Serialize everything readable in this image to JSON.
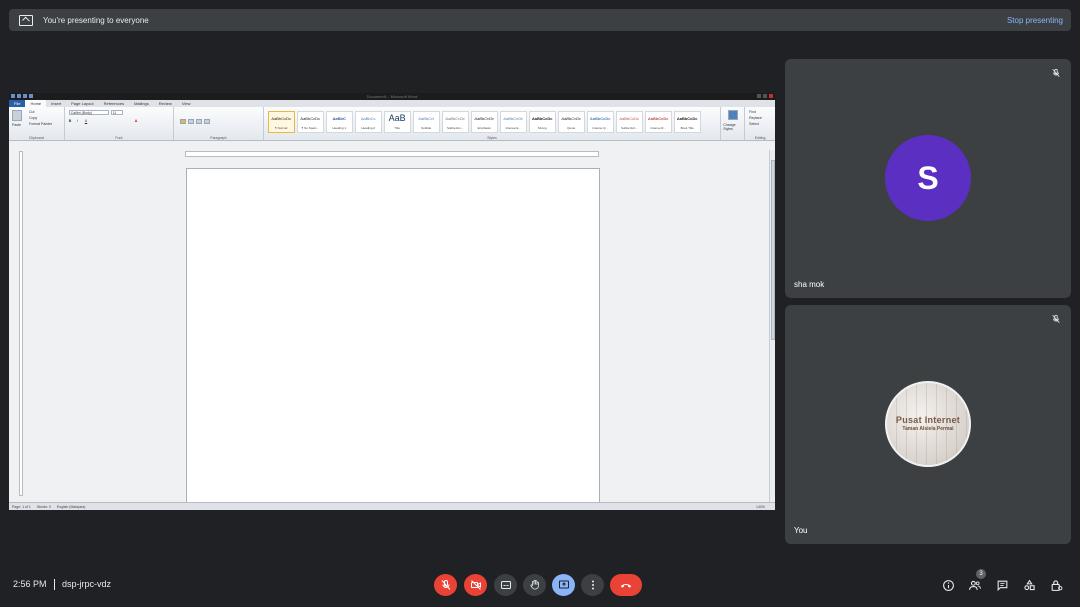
{
  "banner": {
    "message": "You're presenting to everyone",
    "stop_label": "Stop presenting"
  },
  "word": {
    "title": "Document1 - Microsoft Word",
    "tabs": [
      "File",
      "Home",
      "Insert",
      "Page Layout",
      "References",
      "Mailings",
      "Review",
      "View"
    ],
    "active_tab": "Home",
    "clipboard": {
      "paste": "Paste",
      "cut": "Cut",
      "copy": "Copy",
      "format_painter": "Format Painter",
      "group": "Clipboard"
    },
    "font": {
      "name": "Calibri (Body)",
      "size": "11",
      "group": "Font"
    },
    "paragraph_group": "Paragraph",
    "styles_group": "Styles",
    "styles": [
      {
        "preview": "AaBbCcDc",
        "name": "¶ Normal"
      },
      {
        "preview": "AaBbCcDc",
        "name": "¶ No Spaci..."
      },
      {
        "preview": "AaBbC",
        "name": "Heading 1"
      },
      {
        "preview": "AaBbCc",
        "name": "Heading 2"
      },
      {
        "preview": "AaB",
        "name": "Title"
      },
      {
        "preview": "AaBbCcI",
        "name": "Subtitle"
      },
      {
        "preview": "AaBbCcDc",
        "name": "Subtle Em..."
      },
      {
        "preview": "AaBbCcDc",
        "name": "Emphasis"
      },
      {
        "preview": "AaBbCcDc",
        "name": "Intense E..."
      },
      {
        "preview": "AaBbCcDc",
        "name": "Strong"
      },
      {
        "preview": "AaBbCcDc",
        "name": "Quote"
      },
      {
        "preview": "AaBbCcDc",
        "name": "Intense Q..."
      },
      {
        "preview": "AaBbCcDc",
        "name": "Subtle Ref..."
      },
      {
        "preview": "AaBbCcDc",
        "name": "Intense R..."
      },
      {
        "preview": "AaBbCcDc",
        "name": "Book Title"
      }
    ],
    "change_styles": "Change Styles",
    "editing": {
      "find": "Find",
      "replace": "Replace",
      "select": "Select",
      "group": "Editing"
    },
    "status": {
      "page": "Page: 1 of 1",
      "words": "Words: 0",
      "language": "English (Malaysia)",
      "zoom": "140%"
    }
  },
  "participants": [
    {
      "name": "sha mok",
      "initial": "S",
      "avatar_color": "#5b2fc2"
    },
    {
      "name": "You",
      "avatar_text_1": "Pusat Internet",
      "avatar_text_2": "Taman Alsiela Permai"
    }
  ],
  "bottom": {
    "time": "2:56 PM",
    "meeting_code": "dsp-jrpc-vdz",
    "people_count": "3"
  },
  "colors": {
    "background": "#202124",
    "tile": "#3c4043",
    "red": "#ea4335",
    "blue": "#8ab4f8"
  },
  "icons": [
    "present-icon",
    "mic-off-icon",
    "camera-off-icon",
    "captions-icon",
    "raise-hand-icon",
    "present-now-icon",
    "more-options-icon",
    "hang-up-icon",
    "info-icon",
    "people-icon",
    "chat-icon",
    "activities-icon",
    "host-controls-icon"
  ]
}
